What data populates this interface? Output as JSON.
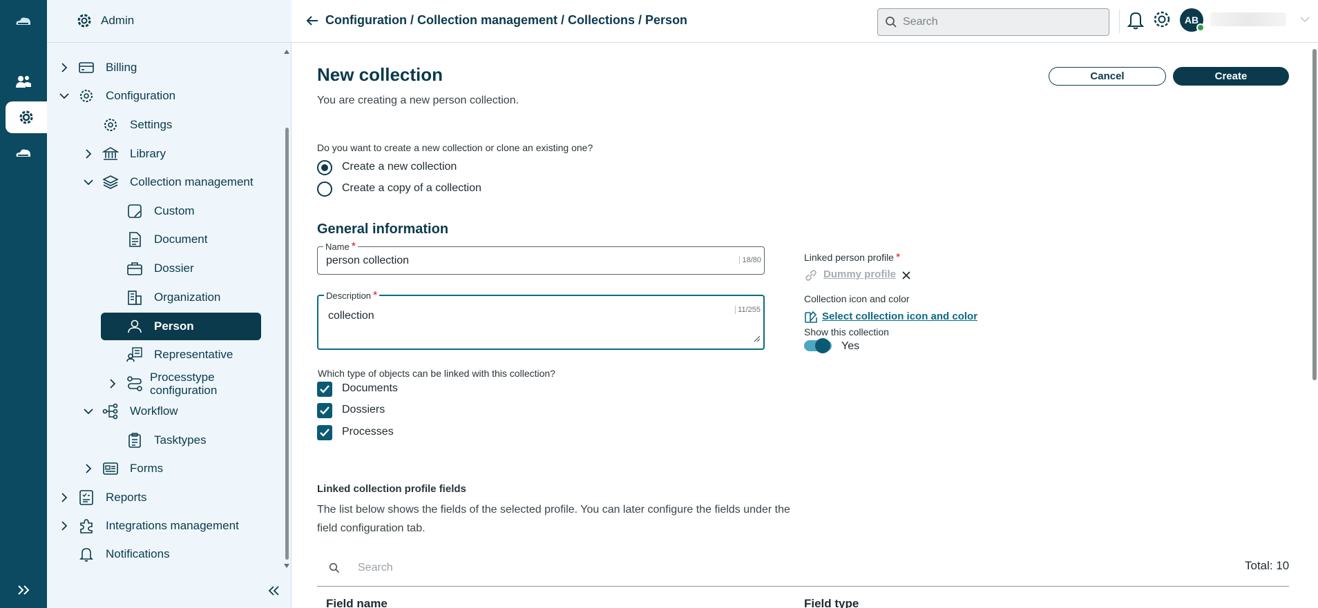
{
  "sidebar": {
    "header_label": "Admin",
    "items": [
      {
        "label": "Billing"
      },
      {
        "label": "Configuration"
      },
      {
        "label": "Settings"
      },
      {
        "label": "Library"
      },
      {
        "label": "Collection management"
      },
      {
        "label": "Custom"
      },
      {
        "label": "Document"
      },
      {
        "label": "Dossier"
      },
      {
        "label": "Organization"
      },
      {
        "label": "Person"
      },
      {
        "label": "Representative"
      },
      {
        "label": "Processtype configuration"
      },
      {
        "label": "Workflow"
      },
      {
        "label": "Tasktypes"
      },
      {
        "label": "Forms"
      },
      {
        "label": "Reports"
      },
      {
        "label": "Integrations management"
      },
      {
        "label": "Notifications"
      }
    ]
  },
  "header": {
    "breadcrumb": "Configuration / Collection management / Collections / Person",
    "search_placeholder": "Search",
    "avatar_initials": "AB"
  },
  "main": {
    "title": "New collection",
    "subtitle": "You are creating a new person collection.",
    "cancel_label": "Cancel",
    "create_label": "Create",
    "question": "Do you want to create a new collection or clone an existing one?",
    "option_new": "Create a new collection",
    "option_copy": "Create a copy of a collection",
    "selected_option": "new",
    "section_general": "General information",
    "name_label": "Name",
    "name_value": "person collection",
    "name_counter": "18/80",
    "description_label": "Description",
    "description_value": "collection",
    "description_counter": "11/255",
    "objects_question": "Which type of objects can be linked with this collection?",
    "objects": [
      {
        "label": "Documents",
        "checked": true
      },
      {
        "label": "Dossiers",
        "checked": true
      },
      {
        "label": "Processes",
        "checked": true
      }
    ],
    "linked_profile_label": "Linked person profile",
    "linked_profile_value": "Dummy profile",
    "icon_color_label": "Collection icon and color",
    "icon_color_link": "Select collection icon and color",
    "show_label": "Show this collection",
    "show_value": "Yes",
    "linked_fields_title": "Linked collection profile fields",
    "linked_fields_desc": "The list below shows the fields of the selected profile. You can later configure the fields under the field configuration tab.",
    "table_search_placeholder": "Search",
    "total": "Total: 10",
    "columns": [
      "Field name",
      "Field type"
    ]
  },
  "colors": {
    "primary": "#0b3a4c",
    "rail": "#0b4a60",
    "sidebar_bg": "#eef6fb",
    "required": "#d4141c",
    "link": "#0b6a85"
  }
}
